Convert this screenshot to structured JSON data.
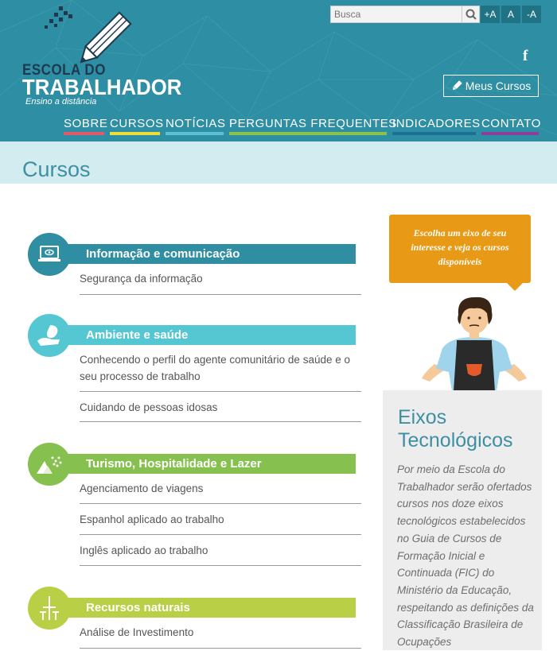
{
  "header": {
    "logo": {
      "line1": "ESCOLA DO",
      "line2": "TRABALHADOR",
      "line3": "Ensino a distância"
    },
    "search": {
      "placeholder": "Busca"
    },
    "font_controls": [
      "+A",
      "A",
      "-A"
    ],
    "social": "f",
    "my_courses_label": "Meus Cursos",
    "nav": [
      {
        "label": "SOBRE",
        "color": "#e05a6b"
      },
      {
        "label": "CURSOS",
        "color": "#f0dc3a"
      },
      {
        "label": "NOTÍCIAS",
        "color": "#5bbfd6"
      },
      {
        "label": "PERGUNTAS FREQUENTES",
        "color": "#8bc24a"
      },
      {
        "label": "INDICADORES",
        "color": "#1d6f95"
      },
      {
        "label": "CONTATO",
        "color": "#8d3d9a"
      }
    ]
  },
  "page_title": "Cursos",
  "categories": [
    {
      "label": "Informação e comunicação",
      "color": "#2f8ea1",
      "icon": "laptop-icon",
      "courses": [
        "Segurança da informação"
      ]
    },
    {
      "label": "Ambiente e saúde",
      "color": "#55c7d3",
      "icon": "leaf-hand-icon",
      "courses": [
        "Conhecendo o perfil do agente comunitário de saúde e o seu processo de trabalho",
        "Cuidando de pessoas idosas"
      ]
    },
    {
      "label": "Turismo, Hospitalidade e Lazer",
      "color": "#86c04e",
      "icon": "mountain-icon",
      "courses": [
        "Agenciamento de viagens",
        "Espanhol aplicado ao trabalho",
        "Inglês aplicado ao trabalho"
      ]
    },
    {
      "label": "Recursos naturais",
      "color": "#b9cf45",
      "icon": "wind-turbine-icon",
      "courses": [
        "Análise de Investimento"
      ]
    }
  ],
  "sidebar": {
    "bubble": "Escolha um eixo de seu interesse e veja os cursos disponíveis",
    "eixos_title": "Eixos Tecnológicos",
    "eixos_text": "Por meio da Escola do Trabalhador serão ofertados cursos nos doze eixos tecnológicos estabelecidos no Guia de Cursos de Formação Inicial e Continuada (FIC) do Ministério da Educação, respeitando as definições da Classificação Brasileira de Ocupações"
  }
}
